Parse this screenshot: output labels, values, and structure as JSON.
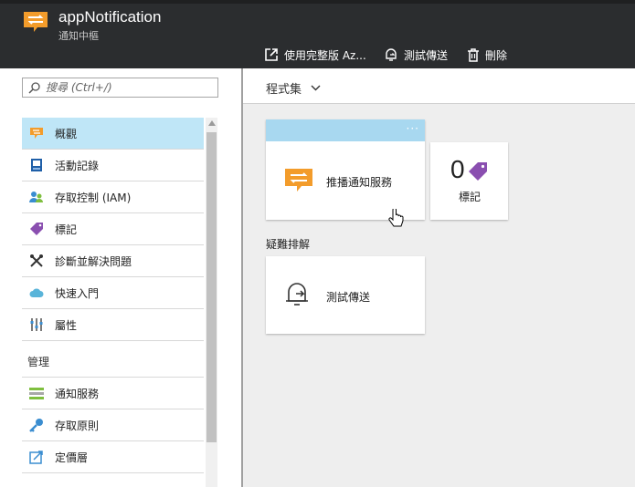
{
  "app": {
    "title": "appNotification",
    "subtitle": "通知中樞"
  },
  "commands": [
    {
      "label": "使用完整版 Az...",
      "icon": "open-external-icon"
    },
    {
      "label": "測試傳送",
      "icon": "bell-send-icon"
    },
    {
      "label": "刪除",
      "icon": "trash-icon"
    }
  ],
  "search": {
    "placeholder": "搜尋 (Ctrl+/)",
    "value": ""
  },
  "menu": {
    "items": [
      {
        "label": "概觀",
        "icon": "overview-icon",
        "active": true
      },
      {
        "label": "活動記錄",
        "icon": "activity-log-icon"
      },
      {
        "label": "存取控制 (IAM)",
        "icon": "access-control-icon"
      },
      {
        "label": "標記",
        "icon": "tag-icon"
      },
      {
        "label": "診斷並解決問題",
        "icon": "wrench-icon"
      },
      {
        "label": "快速入門",
        "icon": "cloud-icon"
      },
      {
        "label": "屬性",
        "icon": "properties-icon"
      }
    ],
    "section_label": "管理",
    "manage_items": [
      {
        "label": "通知服務",
        "icon": "notification-services-icon"
      },
      {
        "label": "存取原則",
        "icon": "key-icon"
      },
      {
        "label": "定價層",
        "icon": "pricing-tier-icon"
      }
    ]
  },
  "collection": {
    "label": "程式集"
  },
  "tiles": {
    "push": {
      "label": "推播通知服務"
    },
    "tags": {
      "count": "0",
      "label": "標記"
    },
    "troubleshoot_section": "疑難排解",
    "test_send": {
      "label": "測試傳送"
    }
  },
  "colors": {
    "header_bg": "#2b2d2f",
    "accent_orange": "#f39c2b",
    "active_item_bg": "#bfe6f7",
    "tile_header": "#a8d8f0",
    "tag_purple": "#8a4fb0"
  }
}
